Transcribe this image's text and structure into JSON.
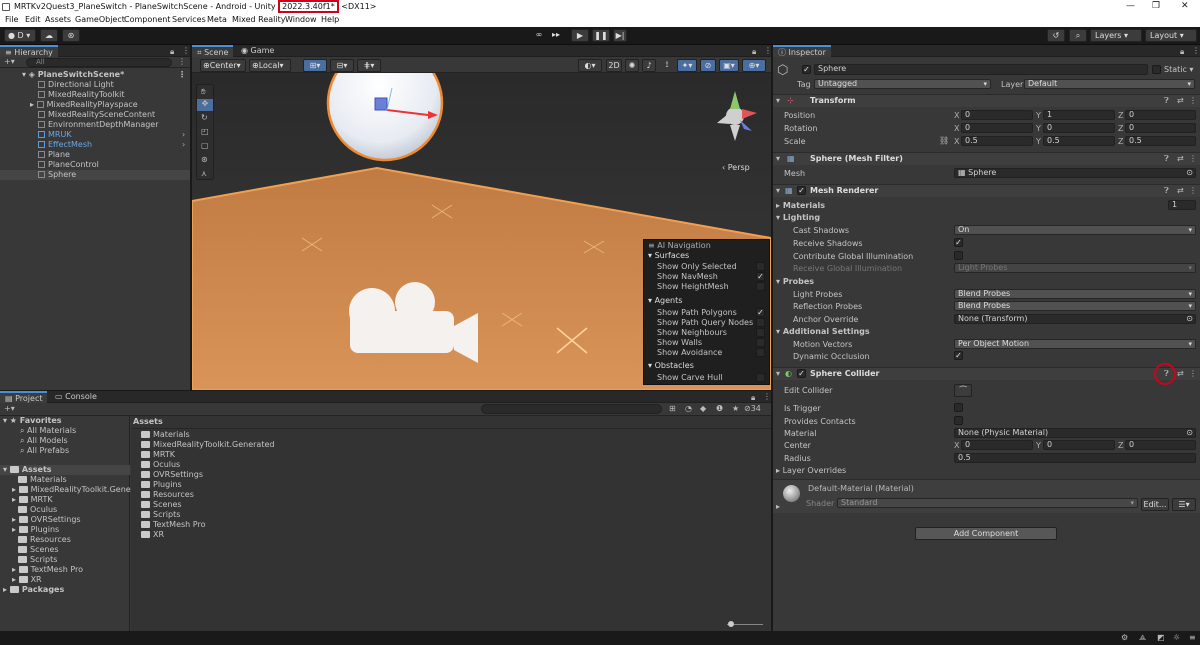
{
  "titlebar": {
    "title_prefix": "MRTKv2Quest3_PlaneSwitch - PlaneSwitchScene - Android - Unity ",
    "version": "2022.3.40f1*",
    "title_suffix": " <DX11>"
  },
  "menu": [
    "File",
    "Edit",
    "Assets",
    "GameObject",
    "Component",
    "Services",
    "Meta",
    "Mixed Reality",
    "Window",
    "Help"
  ],
  "toolbar": {
    "account": "D",
    "layers": "Layers",
    "layout": "Layout"
  },
  "hierarchy": {
    "tab": "Hierarchy",
    "search": "All",
    "scene": "PlaneSwitchScene*",
    "items": [
      "Directional Light",
      "MixedRealityToolkit",
      "MixedRealityPlayspace",
      "MixedRealitySceneContent",
      "EnvironmentDepthManager",
      "MRUK",
      "EffectMesh",
      "Plane",
      "PlaneControl",
      "Sphere"
    ]
  },
  "scene_view": {
    "tabs": [
      "Scene",
      "Game"
    ],
    "pivot": "Center",
    "space": "Local",
    "mode_2d": "2D",
    "persp": "Persp",
    "ai_nav": {
      "title": "AI Navigation",
      "surfaces": "Surfaces",
      "surface_items": [
        "Show Only Selected",
        "Show NavMesh",
        "Show HeightMesh"
      ],
      "agents": "Agents",
      "agent_items": [
        "Show Path Polygons",
        "Show Path Query Nodes",
        "Show Neighbours",
        "Show Walls",
        "Show Avoidance"
      ],
      "obstacles": "Obstacles",
      "obstacle_items": [
        "Show Carve Hull"
      ]
    }
  },
  "project": {
    "tabs": [
      "Project",
      "Console"
    ],
    "favorites": "Favorites",
    "fav_items": [
      "All Materials",
      "All Models",
      "All Prefabs"
    ],
    "assets": "Assets",
    "asset_tree": [
      "Materials",
      "MixedRealityToolkit.Generated",
      "MRTK",
      "Oculus",
      "OVRSettings",
      "Plugins",
      "Resources",
      "Scenes",
      "Scripts",
      "TextMesh Pro",
      "XR"
    ],
    "packages": "Packages",
    "breadcrumb": "Assets",
    "grid_items": [
      "Materials",
      "MixedRealityToolkit.Generated",
      "MRTK",
      "Oculus",
      "OVRSettings",
      "Plugins",
      "Resources",
      "Scenes",
      "Scripts",
      "TextMesh Pro",
      "XR"
    ],
    "count": "34"
  },
  "inspector": {
    "tab": "Inspector",
    "name": "Sphere",
    "static": "Static",
    "tag_label": "Tag",
    "tag": "Untagged",
    "layer_label": "Layer",
    "layer": "Default",
    "transform": {
      "title": "Transform",
      "position": "Position",
      "rotation": "Rotation",
      "scale": "Scale",
      "pos": [
        "0",
        "1",
        "0"
      ],
      "rot": [
        "0",
        "0",
        "0"
      ],
      "scl": [
        "0.5",
        "0.5",
        "0.5"
      ]
    },
    "mesh_filter": {
      "title": "Sphere (Mesh Filter)",
      "mesh_label": "Mesh",
      "mesh": "Sphere"
    },
    "mesh_renderer": {
      "title": "Mesh Renderer",
      "materials": "Materials",
      "materials_count": "1",
      "lighting": "Lighting",
      "cast_shadows": "Cast Shadows",
      "cast_shadows_val": "On",
      "receive_shadows": "Receive Shadows",
      "contribute_gi": "Contribute Global Illumination",
      "receive_gi": "Receive Global Illumination",
      "receive_gi_val": "Light Probes",
      "probes": "Probes",
      "light_probes": "Light Probes",
      "light_probes_val": "Blend Probes",
      "reflection_probes": "Reflection Probes",
      "reflection_probes_val": "Blend Probes",
      "anchor_override": "Anchor Override",
      "anchor_override_val": "None (Transform)",
      "additional": "Additional Settings",
      "motion_vectors": "Motion Vectors",
      "motion_vectors_val": "Per Object Motion",
      "dynamic_occlusion": "Dynamic Occlusion"
    },
    "sphere_collider": {
      "title": "Sphere Collider",
      "edit_collider": "Edit Collider",
      "is_trigger": "Is Trigger",
      "provides_contacts": "Provides Contacts",
      "material": "Material",
      "material_val": "None (Physic Material)",
      "center": "Center",
      "center_val": [
        "0",
        "0",
        "0"
      ],
      "radius": "Radius",
      "radius_val": "0.5",
      "layer_overrides": "Layer Overrides"
    },
    "material": {
      "title": "Default-Material (Material)",
      "shader_label": "Shader",
      "shader": "Standard",
      "edit": "Edit..."
    },
    "add_component": "Add Component"
  },
  "colors": {
    "highlight": "#d0021b",
    "selection_blue": "#5b9ddb",
    "ground": "#d58a4c"
  }
}
